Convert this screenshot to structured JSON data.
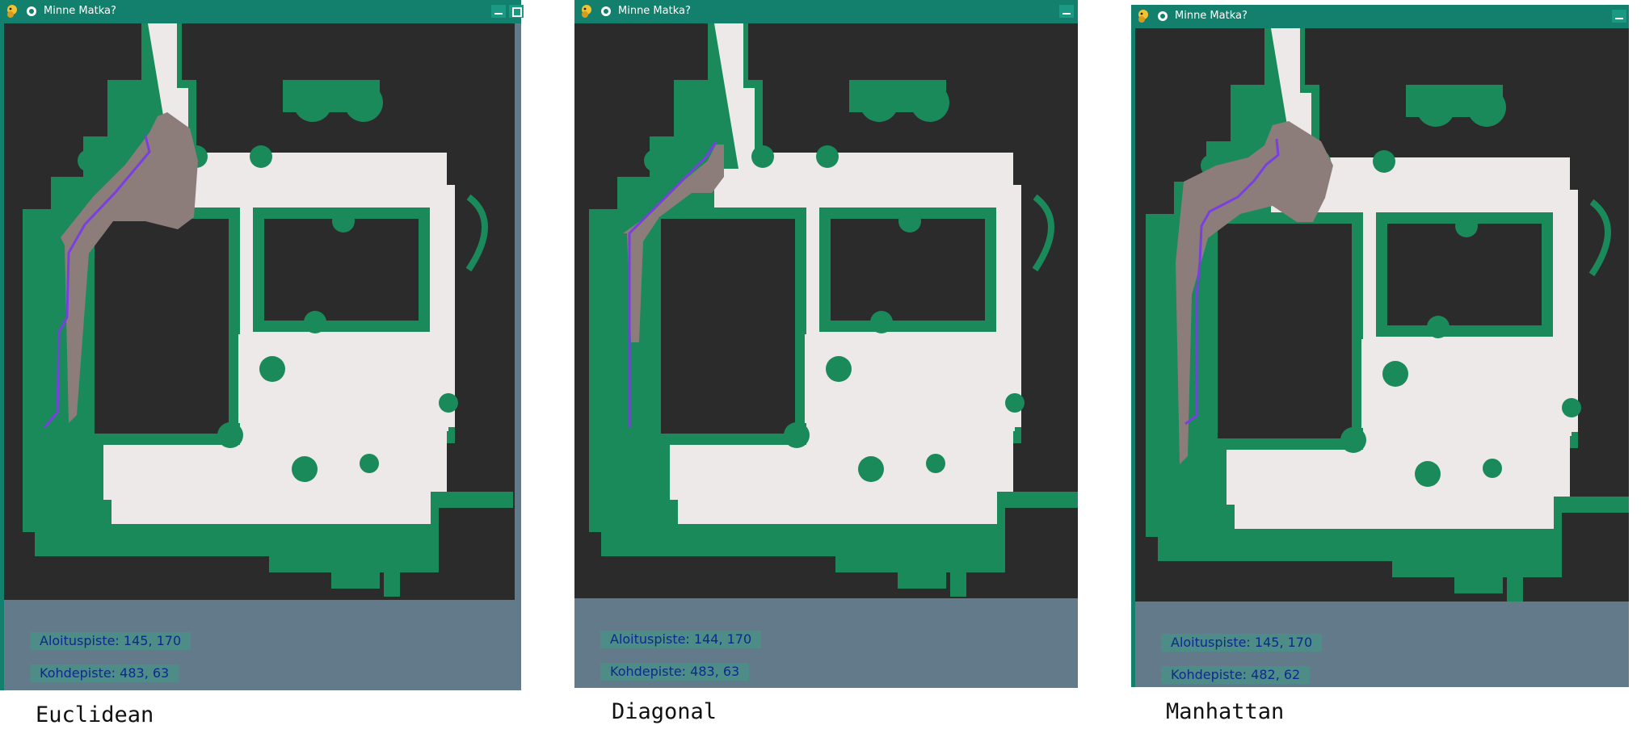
{
  "colors": {
    "titlebar": "#12806c",
    "background": "#2b2b2b",
    "wall": "#1a8a5a",
    "floor": "#ece9e8",
    "explored": "#8c7d7a",
    "path": "#7a3fe0",
    "info_panel": "#637a8a",
    "info_pill": "#4e8d87",
    "info_text": "#0d2a8a"
  },
  "windows": [
    {
      "title": "Minne Matka?",
      "start_label": "Aloituspiste: 145, 170",
      "goal_label": "Kohdepiste: 483, 63",
      "caption": "Euclidean",
      "controls": [
        "minimize-icon",
        "maximize-icon"
      ]
    },
    {
      "title": "Minne Matka?",
      "start_label": "Aloituspiste: 144, 170",
      "goal_label": "Kohdepiste: 483, 63",
      "caption": "Diagonal",
      "controls": [
        "minimize-icon"
      ]
    },
    {
      "title": "Minne Matka?",
      "start_label": "Aloituspiste: 145, 170",
      "goal_label": "Kohdepiste: 482, 62",
      "caption": "Manhattan",
      "controls": [
        "minimize-icon"
      ]
    }
  ]
}
